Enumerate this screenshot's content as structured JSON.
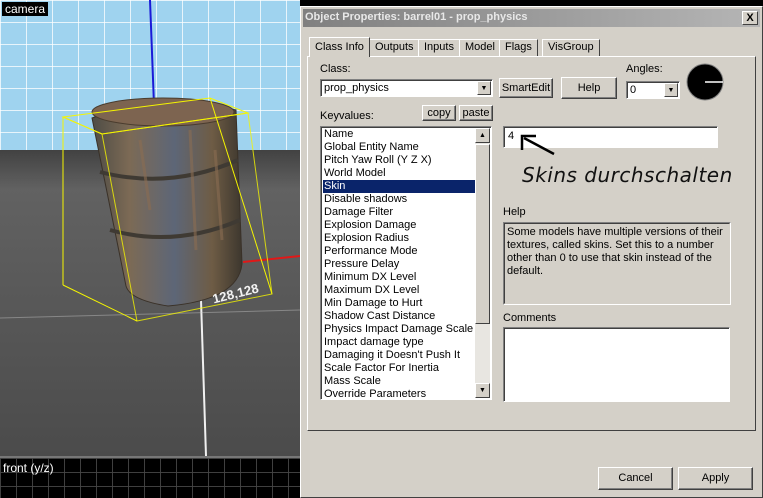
{
  "viewport_camera": {
    "label": "camera",
    "coordinate_label": "128,128"
  },
  "viewport_front": {
    "label": "front (y/z)"
  },
  "dialog": {
    "title": "Object Properties: barrel01 - prop_physics",
    "close_label": "X",
    "tabs": [
      {
        "label": "Class Info",
        "active": true
      },
      {
        "label": "Outputs"
      },
      {
        "label": "Inputs"
      },
      {
        "label": "Model"
      },
      {
        "label": "Flags"
      },
      {
        "label": "VisGroup"
      }
    ],
    "class_label": "Class:",
    "class_value": "prop_physics",
    "smartedit_label": "SmartEdit",
    "help_button_label": "Help",
    "angles_label": "Angles:",
    "angles_value": "0",
    "keyvalues_label": "Keyvalues:",
    "copy_label": "copy",
    "paste_label": "paste",
    "keyvalues": [
      "Name",
      "Global Entity Name",
      "Pitch Yaw Roll (Y Z X)",
      "World Model",
      "Skin",
      "Disable shadows",
      "Damage Filter",
      "Explosion Damage",
      "Explosion Radius",
      "Performance Mode",
      "Pressure Delay",
      "Minimum DX Level",
      "Maximum DX Level",
      "Min Damage to Hurt",
      "Shadow Cast Distance",
      "Physics Impact Damage Scale",
      "Impact damage type",
      "Damaging it Doesn't Push It",
      "Scale Factor For Inertia",
      "Mass Scale",
      "Override Parameters"
    ],
    "selected_keyvalue": "Skin",
    "value": "4",
    "annotation": "Skins durchschalten",
    "help_label": "Help",
    "help_text": "Some models have multiple versions of their textures, called skins. Set this to a number other than 0 to use that skin instead of the default.",
    "comments_label": "Comments",
    "comments_value": "",
    "cancel_label": "Cancel",
    "apply_label": "Apply"
  }
}
